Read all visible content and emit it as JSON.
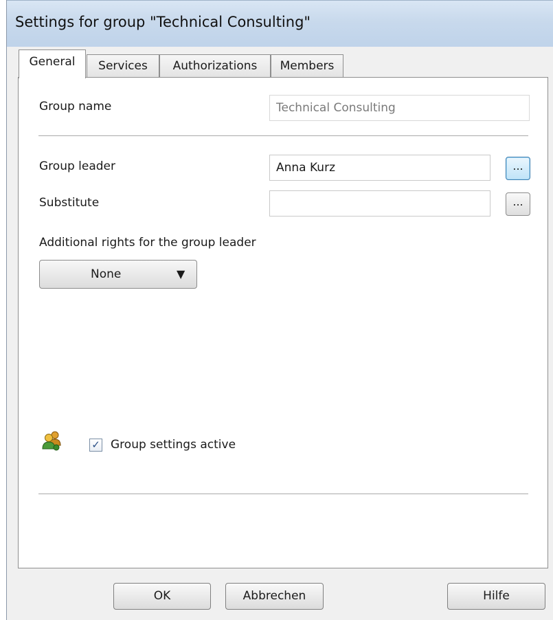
{
  "window": {
    "title": "Settings for group \"Technical Consulting\""
  },
  "tabs": [
    {
      "label": "General",
      "active": true
    },
    {
      "label": "Services",
      "active": false
    },
    {
      "label": "Authorizations",
      "active": false
    },
    {
      "label": "Members",
      "active": false
    }
  ],
  "general": {
    "group_name_label": "Group name",
    "group_name_value": "Technical Consulting",
    "group_leader_label": "Group leader",
    "group_leader_value": "Anna Kurz",
    "substitute_label": "Substitute",
    "substitute_value": "",
    "browse_label": "...",
    "additional_rights_label": "Additional rights for the group leader",
    "additional_rights_value": "None",
    "dropdown_arrow": "▼",
    "group_settings_active_label": "Group settings active",
    "group_settings_active_checked": true,
    "checkmark": "✓",
    "status_icon": "group-users-icon"
  },
  "buttons": {
    "ok": "OK",
    "cancel": "Abbrechen",
    "help": "Hilfe"
  }
}
